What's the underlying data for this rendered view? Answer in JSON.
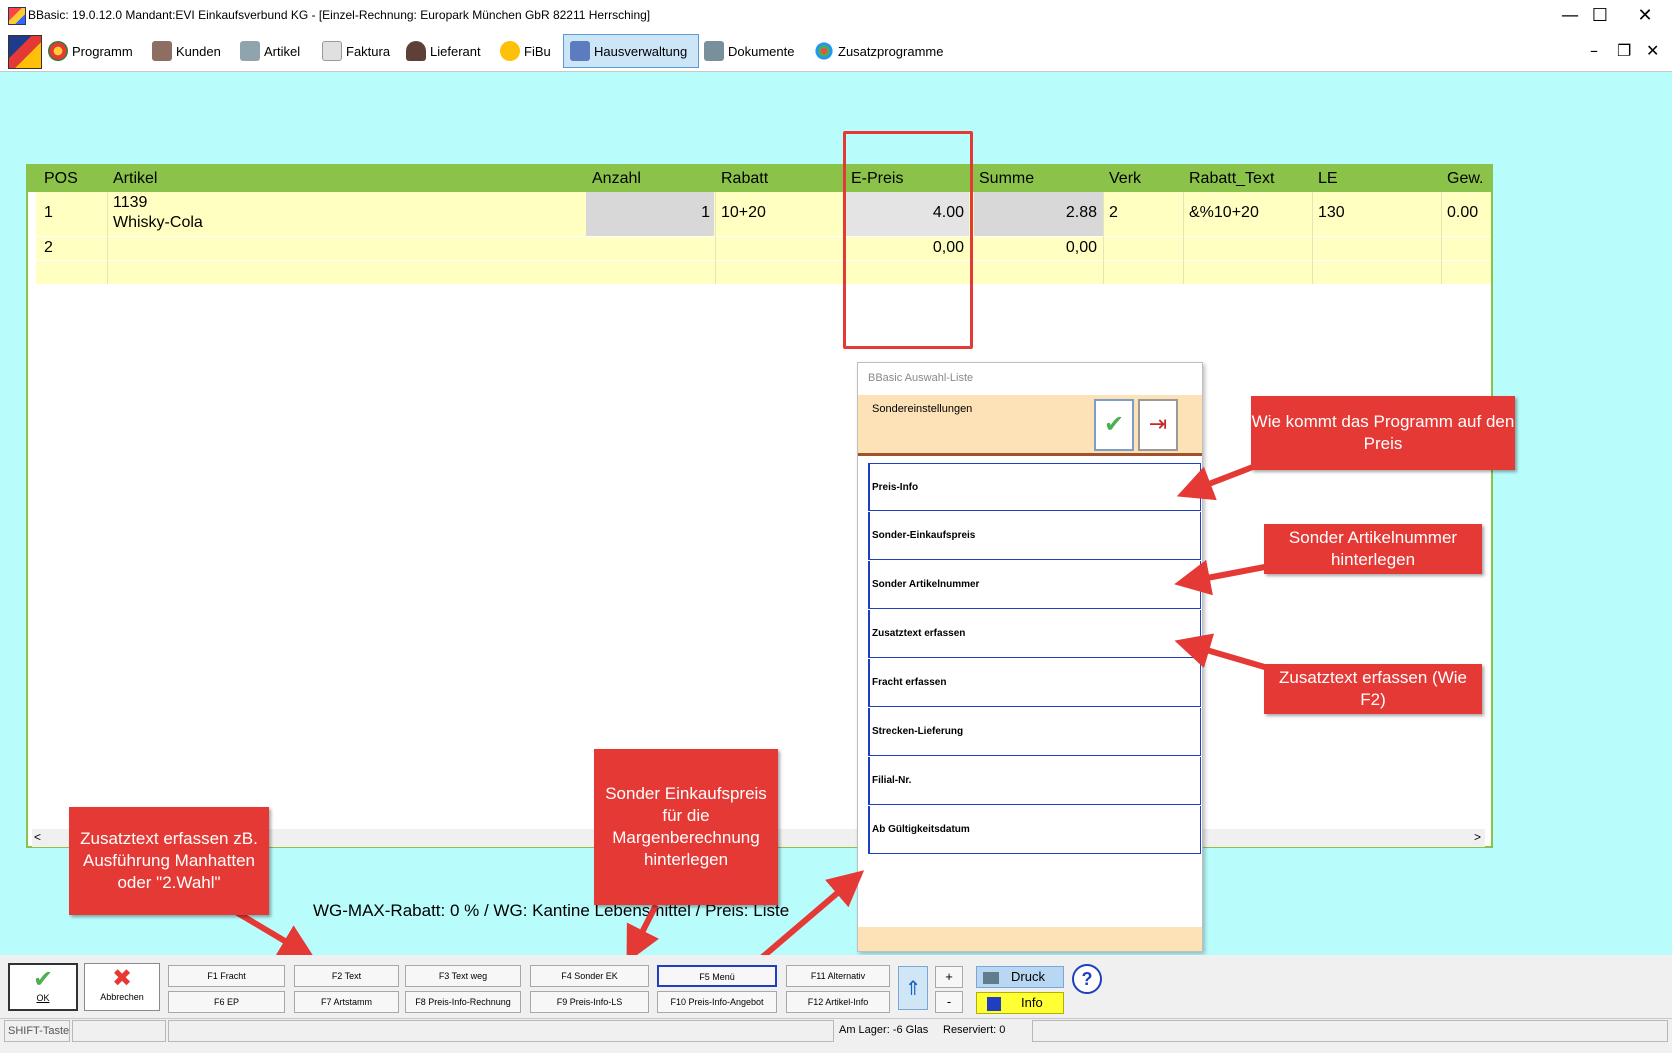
{
  "window": {
    "title": "BBasic: 19.0.12.0 Mandant:EVI Einkaufsverbund KG  - [Einzel-Rechnung: Europark München GbR 82211 Herrsching]",
    "minimize": "—",
    "maximize": "☐",
    "close": "✕"
  },
  "menu": {
    "items": [
      "Programm",
      "Kunden",
      "Artikel",
      "Faktura",
      "Lieferant",
      "FiBu",
      "Hausverwaltung",
      "Dokumente",
      "Zusatzprogramme"
    ],
    "mdi_minimize": "–",
    "mdi_restore": "❐",
    "mdi_close": "✕"
  },
  "grid": {
    "headers": [
      "POS",
      "Artikel",
      "Anzahl",
      "Rabatt",
      "E-Preis",
      "Summe",
      "Verk",
      "Rabatt_Text",
      "LE",
      "Gew."
    ],
    "rows": [
      {
        "pos": "1",
        "artikel_nr": "1139",
        "artikel_name": "Whisky-Cola",
        "anzahl": "1",
        "rabatt": "10+20",
        "epreis": "4.00",
        "summe": "2.88",
        "verk": "2",
        "rabatt_text": "&%10+20",
        "le": "130",
        "gew": "0.00"
      },
      {
        "pos": "2",
        "artikel_nr": "",
        "artikel_name": "",
        "anzahl": "",
        "rabatt": "",
        "epreis": "0,00",
        "summe": "0,00",
        "verk": "",
        "rabatt_text": "",
        "le": "",
        "gew": ""
      }
    ],
    "scroll_left": "<",
    "scroll_right": ">"
  },
  "popup": {
    "title": "BBasic Auswahl-Liste",
    "header_label": "Sondereinstellungen",
    "ok_icon": "✔",
    "exit_icon": "⇥",
    "items": [
      "Preis-Info",
      "Sonder-Einkaufspreis",
      "Sonder Artikelnummer",
      "Zusatztext erfassen",
      "Fracht erfassen",
      "Strecken-Lieferung",
      "Filial-Nr.",
      "Ab Gültigkeitsdatum"
    ]
  },
  "callouts": {
    "preis": "Wie kommt das Programm auf den Preis",
    "artikelnummer": "Sonder Artikelnummer hinterlegen",
    "zusatztext_right": "Zusatztext erfassen (Wie F2)",
    "zusatztext_left": "Zusatztext erfassen zB. Ausführung Manhatten oder \"2.Wahl\"",
    "sonder_ek": "Sonder Einkaufspreis für die Margenberechnung hinterlegen"
  },
  "wg_info": "WG-MAX-Rabatt: 0 %  / WG: Kantine Lebensmittel /  Preis: Liste",
  "toolbar": {
    "ok": "OK",
    "abbrechen": "Abbrechen",
    "fkeys_top": [
      "F1 Fracht",
      "F2 Text",
      "F3 Text weg",
      "F4 Sonder EK",
      "F5 Menü",
      "F11 Alternativ"
    ],
    "fkeys_bottom": [
      "F6 EP",
      "F7 Artstamm",
      "F8 Preis-Info-Rechnung",
      "F9 Preis-Info-LS",
      "F10 Preis-Info-Angebot",
      "F12 Artikel-Info"
    ],
    "plus": "+",
    "minus": "-",
    "druck": "Druck",
    "info": "Info",
    "help": "?"
  },
  "status": {
    "shift": "SHIFT-Taste",
    "lager": "Am Lager: -6 Glas",
    "reserviert": "Reserviert: 0"
  },
  "colors": {
    "background": "#b9fcfc",
    "grid_header": "#8bc34a",
    "row": "#ffffc2",
    "callout": "#e53935",
    "popup_bar": "#fde2b8",
    "item_border": "#1f3fbf"
  }
}
